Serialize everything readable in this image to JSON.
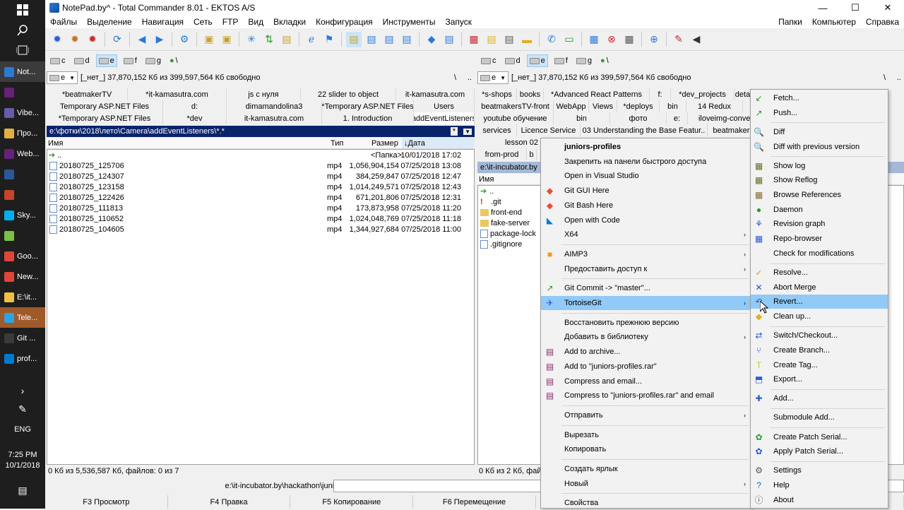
{
  "taskbar": {
    "apps": [
      {
        "label": "Not...",
        "color": "#2a7ad8",
        "state": "active"
      },
      {
        "label": "",
        "color": "#68217a",
        "state": "normal"
      },
      {
        "label": "Vibe...",
        "color": "#665cac",
        "state": "normal"
      },
      {
        "label": "Про...",
        "color": "#e0b040",
        "state": "normal"
      },
      {
        "label": "Web...",
        "color": "#68217a",
        "state": "normal"
      },
      {
        "label": "",
        "color": "#2b579a",
        "state": "normal"
      },
      {
        "label": "",
        "color": "#c8442a",
        "state": "normal"
      },
      {
        "label": "Sky...",
        "color": "#00aff0",
        "state": "normal"
      },
      {
        "label": "",
        "color": "#7ac143",
        "state": "normal"
      },
      {
        "label": "Goo...",
        "color": "#e0453a",
        "state": "normal"
      },
      {
        "label": "New...",
        "color": "#e0453a",
        "state": "normal"
      },
      {
        "label": "E:\\it...",
        "color": "#f0c040",
        "state": "normal"
      },
      {
        "label": "Tele...",
        "color": "#2ca5e0",
        "state": "tele"
      },
      {
        "label": "Git ...",
        "color": "#3a3a3a",
        "state": "normal"
      },
      {
        "label": "prof...",
        "color": "#007acc",
        "state": "normal"
      }
    ],
    "lang": "ENG",
    "time": "7:25 PM",
    "date": "10/1/2018"
  },
  "window": {
    "title": "NotePad.by^ - Total Commander 8.01 - EKTOS A/S",
    "btn_min": "—",
    "btn_max": "☐",
    "btn_close": "✕"
  },
  "menu": {
    "items": [
      "Файлы",
      "Выделение",
      "Навигация",
      "Сеть",
      "FTP",
      "Вид",
      "Вкладки",
      "Конфигурация",
      "Инструменты",
      "Запуск"
    ],
    "right_items": [
      "Папки",
      "Компьютер",
      "Справка"
    ]
  },
  "left": {
    "drives": [
      {
        "letter": "c",
        "selected": false
      },
      {
        "letter": "d",
        "selected": false
      },
      {
        "letter": "e",
        "selected": true
      },
      {
        "letter": "f",
        "selected": false
      },
      {
        "letter": "g",
        "selected": false
      },
      {
        "letter": "\\",
        "selected": false
      }
    ],
    "drive_combo": "e",
    "free": "[_нет_]  37,870,152 Кб из 399,597,564 Кб свободно",
    "root_btn": "\\",
    "parent_btn": "..",
    "tabs_row1": [
      "*beatmakerTV",
      "*it-kamasutra.com",
      "js с нуля",
      "22 slider to object",
      "it-kamasutra.com"
    ],
    "tabs_row2": [
      "Temporary ASP.NET Files",
      "d:",
      "dimamandolina3",
      "*Temporary ASP.NET Files",
      "Users"
    ],
    "tabs_row3": [
      "*Temporary ASP.NET Files",
      "*dev",
      "it-kamasutra.com",
      "1. Introduction",
      "addEventListeners"
    ],
    "path": "e:\\фотки\\2018\\лето\\Camera\\addEventListeners\\*.*",
    "path_star": "*",
    "path_arrow": "▼",
    "columns": {
      "name": "Имя",
      "type": "Тип",
      "size": "Размер",
      "date": "Дата",
      "sort_arrow": "↓"
    },
    "up_row": {
      "name": "..",
      "size": "<Папка>",
      "date": "10/01/2018 17:02"
    },
    "files": [
      {
        "name": "20180725_125706",
        "type": "mp4",
        "size": "1,056,904,154",
        "date": "07/25/2018 13:08"
      },
      {
        "name": "20180725_124307",
        "type": "mp4",
        "size": "384,259,847",
        "date": "07/25/2018 12:47"
      },
      {
        "name": "20180725_123158",
        "type": "mp4",
        "size": "1,014,249,571",
        "date": "07/25/2018 12:43"
      },
      {
        "name": "20180725_122426",
        "type": "mp4",
        "size": "671,201,806",
        "date": "07/25/2018 12:31"
      },
      {
        "name": "20180725_111813",
        "type": "mp4",
        "size": "173,873,958",
        "date": "07/25/2018 11:20"
      },
      {
        "name": "20180725_110652",
        "type": "mp4",
        "size": "1,024,048,769",
        "date": "07/25/2018 11:18"
      },
      {
        "name": "20180725_104605",
        "type": "mp4",
        "size": "1,344,927,684",
        "date": "07/25/2018 11:00"
      }
    ],
    "status": "0 Кб из 5,536,587 Кб, файлов: 0 из 7"
  },
  "right": {
    "drives": [
      {
        "letter": "c",
        "selected": false
      },
      {
        "letter": "d",
        "selected": false
      },
      {
        "letter": "e",
        "selected": true
      },
      {
        "letter": "f",
        "selected": false
      },
      {
        "letter": "g",
        "selected": false
      },
      {
        "letter": "\\",
        "selected": false
      }
    ],
    "drive_combo": "e",
    "free": "[_нет_]  37,870,152 Кб из 399,597,564 Кб свободно",
    "root_btn": "\\",
    "parent_btn": "..",
    "tabs_row1": [
      "*s-shops",
      "books",
      "*Advanced React Patterns",
      "f:",
      "*dev_projects",
      "deta"
    ],
    "tabs_row2": [
      "beatmakersTV-front",
      "WebApp",
      "Views",
      "*deploys",
      "bin",
      "14 Redux"
    ],
    "tabs_row3": [
      "youtube обучение",
      "bin",
      "фото",
      "e:",
      "iloveimg-converted ("
    ],
    "tabs_row4": [
      "services",
      "Licence Service",
      "03 Understanding the Base Featur..",
      "beatmakersT"
    ],
    "tabs_row5": [
      "lesson 02"
    ],
    "tabs_row6": [
      "from-prod",
      "b"
    ],
    "path": "e:\\it-incubator.by",
    "col_name": "Имя",
    "items": [
      {
        "name": "..",
        "kind": "up"
      },
      {
        "name": ".git",
        "kind": "gitfolder"
      },
      {
        "name": "front-end",
        "kind": "folder"
      },
      {
        "name": "fake-server",
        "kind": "folder"
      },
      {
        "name": "package-lock",
        "kind": "file"
      },
      {
        "name": ".gitignore",
        "kind": "file"
      }
    ],
    "status": "0 Кб из 2 Кб, файл"
  },
  "cmdline": {
    "path": "e:\\it-incubator.by\\hackathon\\juniors-profiles>"
  },
  "fkeys": [
    "F3 Просмотр",
    "F4 Правка",
    "F5 Копирование",
    "F6 Перемещение",
    "",
    "",
    ""
  ],
  "context_menu": {
    "items": [
      {
        "label": "juniors-profiles",
        "icon": "",
        "bold": true,
        "arrow": false
      },
      {
        "label": "Закрепить на панели быстрого доступа",
        "icon": "",
        "arrow": false
      },
      {
        "label": "Open in Visual Studio",
        "icon": "",
        "arrow": false
      },
      {
        "label": "Git GUI Here",
        "icon": "◆",
        "color": "#e94e31",
        "arrow": false
      },
      {
        "label": "Git Bash Here",
        "icon": "◆",
        "color": "#e94e31",
        "arrow": false
      },
      {
        "label": "Open with Code",
        "icon": "◣",
        "color": "#0078d7",
        "arrow": false
      },
      {
        "label": "X64",
        "icon": "",
        "arrow": true
      },
      {
        "sep": true
      },
      {
        "label": "AIMP3",
        "icon": "■",
        "color": "#f39c12",
        "arrow": true
      },
      {
        "label": "Предоставить доступ к",
        "icon": "",
        "arrow": true
      },
      {
        "sep": true
      },
      {
        "label": "Git Commit -> \"master\"...",
        "icon": "↗",
        "color": "#2a9a2a",
        "arrow": false
      },
      {
        "label": "TortoiseGit",
        "icon": "✈",
        "color": "#2a5ad8",
        "arrow": true,
        "hi": true
      },
      {
        "sep": true
      },
      {
        "label": "Восстановить прежнюю версию",
        "icon": "",
        "arrow": false
      },
      {
        "label": "Добавить в библиотеку",
        "icon": "",
        "arrow": true
      },
      {
        "label": "Add to archive...",
        "icon": "▤",
        "color": "#8a2a6a",
        "arrow": false
      },
      {
        "label": "Add to \"juniors-profiles.rar\"",
        "icon": "▤",
        "color": "#8a2a6a",
        "arrow": false
      },
      {
        "label": "Compress and email...",
        "icon": "▤",
        "color": "#8a2a6a",
        "arrow": false
      },
      {
        "label": "Compress to \"juniors-profiles.rar\" and email",
        "icon": "▤",
        "color": "#8a2a6a",
        "arrow": false
      },
      {
        "sep": true
      },
      {
        "label": "Отправить",
        "icon": "",
        "arrow": true
      },
      {
        "sep": true
      },
      {
        "label": "Вырезать",
        "icon": "",
        "arrow": false
      },
      {
        "label": "Копировать",
        "icon": "",
        "arrow": false
      },
      {
        "sep": true
      },
      {
        "label": "Создать ярлык",
        "icon": "",
        "arrow": false
      },
      {
        "label": "Новый",
        "icon": "",
        "arrow": true
      },
      {
        "sep": true
      },
      {
        "label": "Свойства",
        "icon": "",
        "arrow": false
      }
    ]
  },
  "submenu": {
    "items": [
      {
        "label": "Fetch...",
        "icon": "↙",
        "color": "#2a9a2a"
      },
      {
        "label": "Push...",
        "icon": "↗",
        "color": "#2a9a2a"
      },
      {
        "sep": true
      },
      {
        "label": "Diff",
        "icon": "🔍",
        "color": "#333"
      },
      {
        "label": "Diff with previous version",
        "icon": "🔍",
        "color": "#333"
      },
      {
        "sep": true
      },
      {
        "label": "Show log",
        "icon": "▦",
        "color": "#6a6a2a"
      },
      {
        "label": "Show Reflog",
        "icon": "▦",
        "color": "#6a6a2a"
      },
      {
        "label": "Browse References",
        "icon": "▦",
        "color": "#8a6a2a"
      },
      {
        "label": "Daemon",
        "icon": "●",
        "color": "#2a9a2a"
      },
      {
        "label": "Revision graph",
        "icon": "⚘",
        "color": "#2a5ad8"
      },
      {
        "label": "Repo-browser",
        "icon": "▦",
        "color": "#2a5ad8"
      },
      {
        "label": "Check for modifications",
        "icon": "",
        "color": "#333"
      },
      {
        "sep": true
      },
      {
        "label": "Resolve...",
        "icon": "✓",
        "color": "#c8a22a"
      },
      {
        "label": "Abort Merge",
        "icon": "✕",
        "color": "#2a4ad8"
      },
      {
        "label": "Revert...",
        "icon": "↶",
        "color": "#2a5ad8",
        "hi": true
      },
      {
        "label": "Clean up...",
        "icon": "◆",
        "color": "#e0b020"
      },
      {
        "sep": true
      },
      {
        "label": "Switch/Checkout...",
        "icon": "⇄",
        "color": "#2a5ad8"
      },
      {
        "label": "Create Branch...",
        "icon": "⑂",
        "color": "#2a5ad8"
      },
      {
        "label": "Create Tag...",
        "icon": "T",
        "color": "#c8c820"
      },
      {
        "label": "Export...",
        "icon": "⬒",
        "color": "#2a5ad8"
      },
      {
        "sep": true
      },
      {
        "label": "Add...",
        "icon": "✚",
        "color": "#2a5ad8"
      },
      {
        "sep": true
      },
      {
        "label": "Submodule Add...",
        "icon": "",
        "color": "#333"
      },
      {
        "sep": true
      },
      {
        "label": "Create Patch Serial...",
        "icon": "✿",
        "color": "#2a9a2a"
      },
      {
        "label": "Apply Patch Serial...",
        "icon": "✿",
        "color": "#2a5ad8"
      },
      {
        "sep": true
      },
      {
        "label": "Settings",
        "icon": "⚙",
        "color": "#555"
      },
      {
        "label": "Help",
        "icon": "?",
        "color": "#2a5ad8"
      },
      {
        "label": "About",
        "icon": "ⓘ",
        "color": "#555"
      }
    ]
  }
}
